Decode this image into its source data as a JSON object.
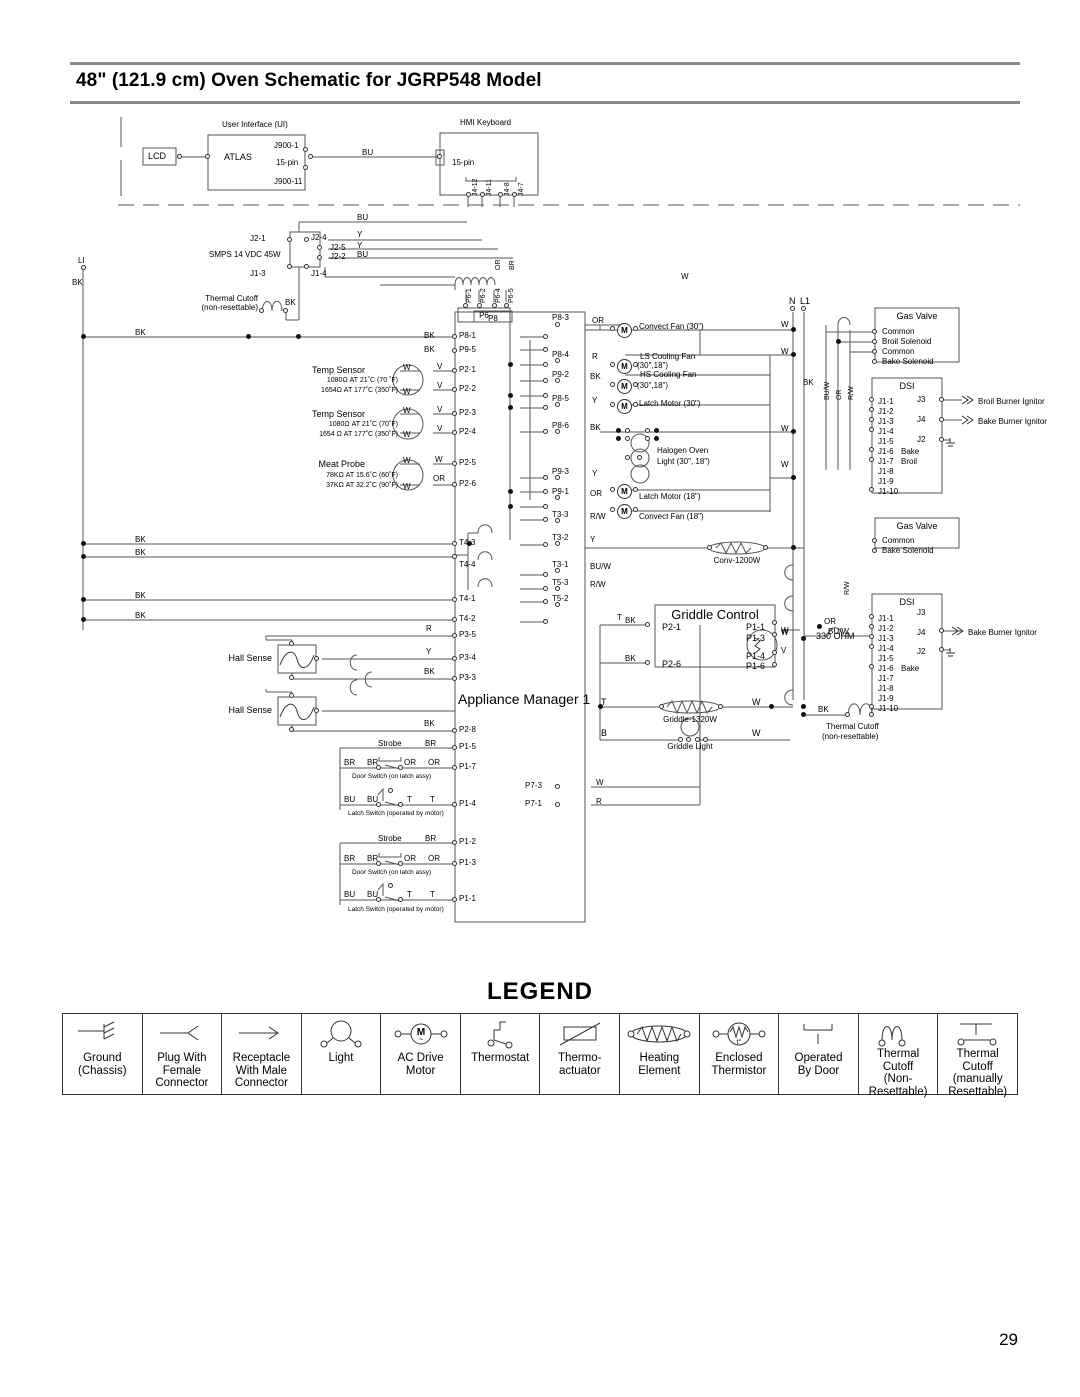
{
  "page": {
    "title": "48\" (121.9 cm) Oven Schematic for JGRP548 Model",
    "number": "29"
  },
  "blocks": {
    "ui": {
      "title": "User Interface (UI)",
      "chip": "ATLAS",
      "lcd": "LCD",
      "pin_top": "J900-1",
      "pin_mid": "15-pin",
      "pin_bot": "J900-11"
    },
    "hmi": {
      "title": "HMI Keyboard",
      "pin": "15-pin",
      "pins": [
        "J4-12",
        "J4-11",
        "J4-8",
        "J4-7"
      ]
    },
    "smps": {
      "title": "SMPS 14 VDC 45W",
      "pins_left": [
        "J2-1",
        "J1-3"
      ],
      "pins_right": [
        "J2-4",
        "J2-5",
        "J2-2",
        "J1-4"
      ]
    },
    "appliance_manager": {
      "title": "Appliance Manager 1"
    },
    "griddle_control": {
      "title": "Griddle Control",
      "left_pins": [
        "P2-1",
        "P2-6"
      ],
      "right_pins": [
        "P1-1",
        "P1-3",
        "P1-4",
        "P1-6"
      ]
    },
    "gas_valve_top": {
      "title": "Gas Valve",
      "terminals": [
        "Common",
        "Broil Solenoid",
        "Common",
        "Bake Solenoid"
      ]
    },
    "gas_valve_bottom": {
      "title": "Gas Valve",
      "terminals": [
        "Common",
        "Bake Solenoid"
      ]
    },
    "dsi_top": {
      "title": "DSI",
      "j1": [
        "J1-1",
        "J1-2",
        "J1-3",
        "J1-4",
        "J1-5",
        "J1-6",
        "J1-7",
        "J1-8",
        "J1-9",
        "J1-10"
      ],
      "j1_notes": {
        "J1-6": "Bake",
        "J1-7": "Broil"
      },
      "outputs": [
        {
          "pin": "J3",
          "label": "Broil Burner Ignitor"
        },
        {
          "pin": "J4",
          "label": "Bake Burner Ignitor"
        },
        {
          "pin": "J2",
          "label": ""
        }
      ]
    },
    "dsi_bottom": {
      "title": "DSI",
      "j1": [
        "J1-1",
        "J1-2",
        "J1-3",
        "J1-4",
        "J1-5",
        "J1-6",
        "J1-7",
        "J1-8",
        "J1-9",
        "J1-10"
      ],
      "j1_notes": {
        "J1-6": "Bake"
      },
      "outputs": [
        {
          "pin": "J3",
          "label": ""
        },
        {
          "pin": "J4",
          "label": "Bake Burner Ignitor"
        },
        {
          "pin": "J2",
          "label": ""
        }
      ]
    },
    "p6": {
      "title": "P6",
      "pins": [
        "P6-1",
        "P6-2",
        "P6-4",
        "P6-5"
      ]
    },
    "p8": {
      "title": "P8"
    }
  },
  "components": {
    "temp_sensor_1": {
      "name": "Temp Sensor",
      "spec1": "1080Ω  AT 21˚C (70 ˚F)",
      "spec2": "1654Ω AT 177˚C (350˚F)"
    },
    "temp_sensor_2": {
      "name": "Temp Sensor",
      "spec1": "1080Ω AT 21˚C (70˚F)",
      "spec2": "1654 Ω  AT 177˚C (350˚F)"
    },
    "meat_probe": {
      "name": "Meat Probe",
      "spec1": "78KΩ AT 15.6˚C (60˚F)",
      "spec2": "37KΩ AT 32.2˚C (90˚F)"
    },
    "thermal_cutoff_1": {
      "l1": "Thermal Cutoff",
      "l2": "(non-resettable)"
    },
    "thermal_cutoff_2": {
      "l1": "Thermal Cutoff",
      "l2": "(non-resettable)"
    },
    "hall_sense_1": "Hall Sense",
    "hall_sense_2": "Hall Sense",
    "conv_element": "Conv-1200W",
    "griddle_element": "Griddle-1320W",
    "griddle_light": "Griddle Light",
    "halogen_light": {
      "l1": "Halogen Oven",
      "l2": "Light (30\", 18\")"
    },
    "resistor_330": "330 OHM",
    "motors": [
      {
        "name": "Convect Fan (30\")",
        "wire": "OR",
        "pin": "P8-3"
      },
      {
        "name": "LS Cooling Fan",
        "name2": "(30\",18\")",
        "wire": "R",
        "pin": "P8-4"
      },
      {
        "name": "HS Cooling Fan",
        "name2": "(30\",18\")",
        "wire": "BK",
        "pin": "P9-2"
      },
      {
        "name": "Latch Motor (30\")",
        "wire": "Y",
        "pin": "P8-5"
      },
      {
        "name": "Latch Motor (18\")",
        "wire": "Y",
        "pin": "P9-3"
      },
      {
        "name": "Convect Fan (18\")",
        "wire": "OR",
        "pin": "P9-1"
      }
    ],
    "door_switch_1": {
      "strobe": "Strobe",
      "door": "Door Switch (on latch assy)",
      "latch": "Latch Switch (operated by motor)"
    },
    "door_switch_2": {
      "strobe": "Strobe",
      "door": "Door Switch (on latch assy)",
      "latch": "Latch Switch (operated by motor)"
    }
  },
  "terminals": {
    "mains": {
      "L1_left": "LI",
      "N": "N",
      "L1": "L1"
    },
    "p8_p9_left": [
      "P8-1",
      "P9-5"
    ],
    "sensor_pins": [
      "P2-1",
      "P2-2",
      "P2-3",
      "P2-4",
      "P2-5",
      "P2-6"
    ],
    "t_pins_mid": [
      "T4-3",
      "T4-4",
      "T4-1",
      "T4-2"
    ],
    "t_pins_right": [
      "T3-3",
      "T3-2",
      "T3-1",
      "T5-3",
      "T5-2"
    ],
    "p3_pins": [
      "P3-5",
      "P3-4",
      "P3-3"
    ],
    "p2_8": "P2-8",
    "p1_pins_upper": [
      "P1-5",
      "P1-7",
      "P1-4"
    ],
    "p1_pins_lower": [
      "P1-2",
      "P1-3",
      "P1-1"
    ],
    "p7_pins": [
      "P7-3",
      "P7-1"
    ],
    "p8_right": [
      "P8-3",
      "P8-4",
      "P8-5",
      "P8-6"
    ],
    "p9_right": [
      "P9-2",
      "P9-3",
      "P9-1"
    ]
  },
  "wire_colors": {
    "bk": "BK",
    "bu": "BU",
    "y": "Y",
    "w": "W",
    "r": "R",
    "v": "V",
    "or": "OR",
    "br": "BR",
    "rw": "R/W",
    "buw": "BU/W",
    "t": "T",
    "b": "B"
  },
  "legend": {
    "title": "LEGEND",
    "items": [
      {
        "icon": "ground-chassis-icon",
        "lines": [
          "Ground",
          "(Chassis)"
        ]
      },
      {
        "icon": "plug-female-connector-icon",
        "lines": [
          "Plug With",
          "Female",
          "Connector"
        ]
      },
      {
        "icon": "receptacle-male-connector-icon",
        "lines": [
          "Receptacle",
          "With Male",
          "Connector"
        ]
      },
      {
        "icon": "light-icon",
        "lines": [
          "Light"
        ]
      },
      {
        "icon": "ac-drive-motor-icon",
        "lines": [
          "AC Drive",
          "Motor"
        ]
      },
      {
        "icon": "thermostat-icon",
        "lines": [
          "Thermostat"
        ]
      },
      {
        "icon": "thermo-actuator-icon",
        "lines": [
          "Thermo-",
          "actuator"
        ]
      },
      {
        "icon": "heating-element-icon",
        "lines": [
          "Heating",
          "Element"
        ]
      },
      {
        "icon": "enclosed-thermistor-icon",
        "lines": [
          "Enclosed",
          "Thermistor"
        ]
      },
      {
        "icon": "operated-by-door-icon",
        "lines": [
          "Operated",
          "By Door"
        ]
      },
      {
        "icon": "thermal-cutoff-nonresettable-icon",
        "lines": [
          "Thermal Cutoff",
          "(Non-",
          "Resettable)"
        ]
      },
      {
        "icon": "thermal-cutoff-resettable-icon",
        "lines": [
          "Thermal Cutoff",
          "(manually",
          "Resettable)"
        ]
      }
    ]
  }
}
